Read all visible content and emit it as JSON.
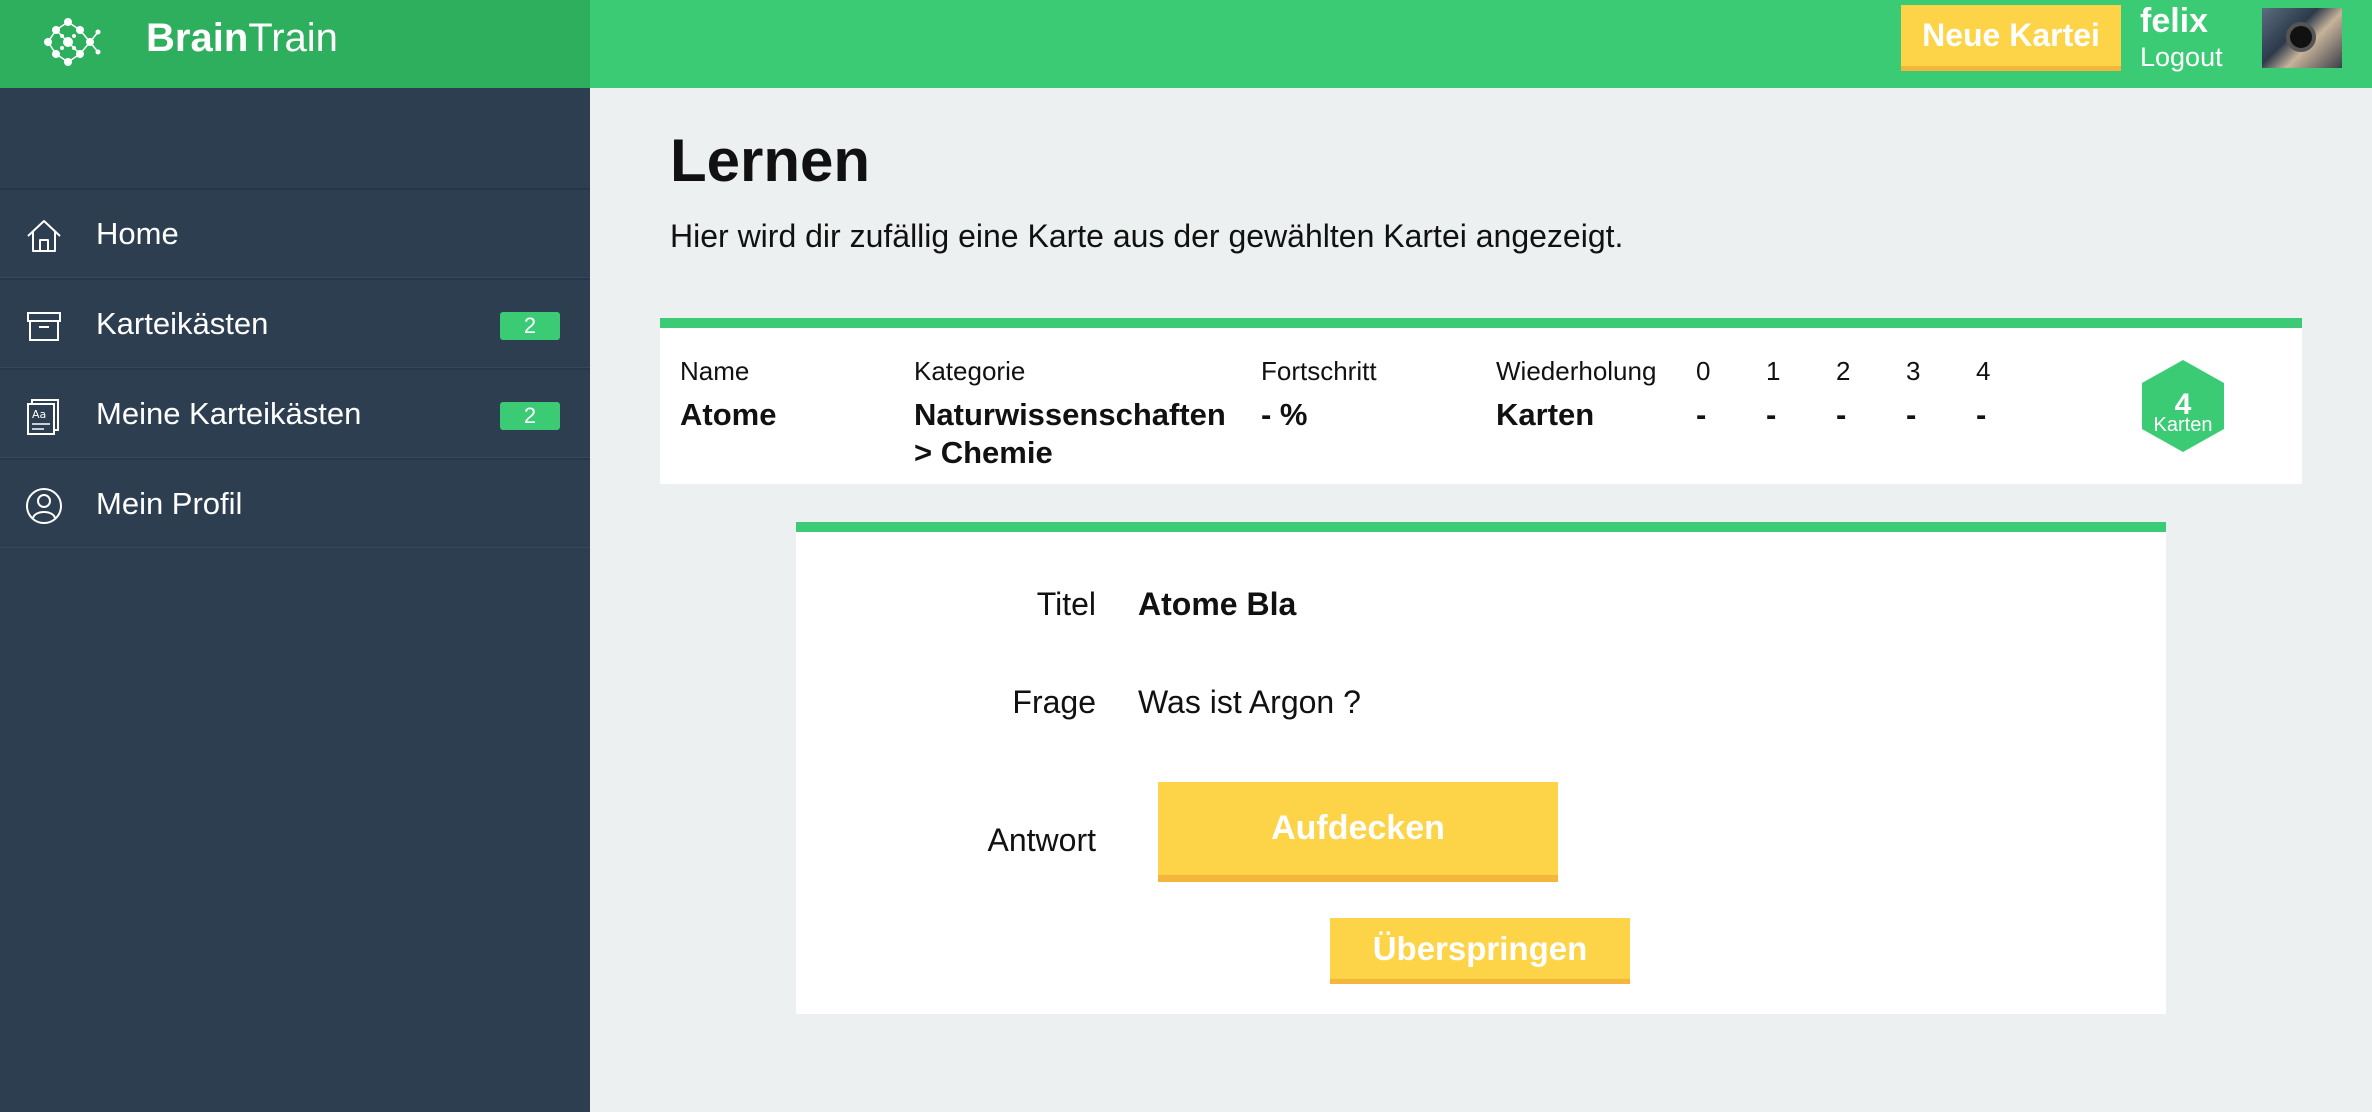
{
  "header": {
    "brand_bold": "Brain",
    "brand_light": "Train",
    "new_button": "Neue Kartei",
    "username": "felix",
    "logout": "Logout",
    "accent_color": "#3acb74",
    "button_color": "#fdd448"
  },
  "sidebar": {
    "items": [
      {
        "label": "Home",
        "icon": "home-icon"
      },
      {
        "label": "Karteikästen",
        "icon": "archive-box-icon",
        "badge": "2"
      },
      {
        "label": "Meine Karteikästen",
        "icon": "cards-icon",
        "badge": "2"
      },
      {
        "label": "Mein Profil",
        "icon": "user-profile-icon"
      }
    ]
  },
  "main": {
    "title": "Lernen",
    "subtitle": "Hier wird dir zufällig eine Karte aus der gewählten Kartei angezeigt."
  },
  "info": {
    "name_label": "Name",
    "name_value": "Atome",
    "category_label": "Kategorie",
    "category_value_line1": "Naturwissenschaften",
    "category_value_line2": "> Chemie",
    "progress_label": "Fortschritt",
    "progress_value": "- %",
    "repeat_label": "Wiederholung",
    "repeat_value": "Karten",
    "levels": [
      {
        "label": "0",
        "value": "-"
      },
      {
        "label": "1",
        "value": "-"
      },
      {
        "label": "2",
        "value": "-"
      },
      {
        "label": "3",
        "value": "-"
      },
      {
        "label": "4",
        "value": "-"
      }
    ],
    "cards_count": "4",
    "cards_label": "Karten"
  },
  "card": {
    "title_label": "Titel",
    "title_value": "Atome Bla",
    "question_label": "Frage",
    "question_value": "Was ist Argon ?",
    "answer_label": "Antwort",
    "reveal_button": "Aufdecken",
    "skip_button": "Überspringen"
  }
}
